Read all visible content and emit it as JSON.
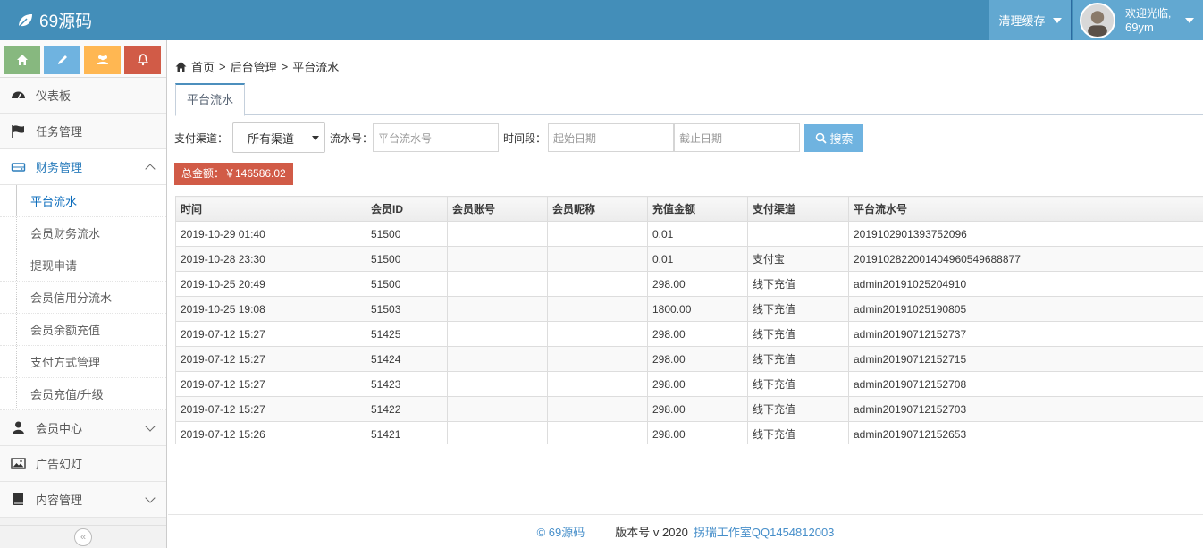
{
  "header": {
    "brand": "69源码",
    "clear_cache": "清理缓存",
    "welcome": "欢迎光临,",
    "username": "69ym"
  },
  "colors": {
    "topbar": "#438eb9",
    "shortcut_green": "#87b87f",
    "shortcut_blue": "#6fb3e0",
    "shortcut_orange": "#ffb752",
    "shortcut_red": "#d15b47",
    "total_badge": "#d15b47",
    "search_button": "#6fb3e0"
  },
  "sidebar": {
    "shortcuts": [
      "home-icon",
      "pencil-icon",
      "users-icon",
      "bell-icon"
    ],
    "items": [
      {
        "label": "仪表板",
        "icon": "dashboard-icon"
      },
      {
        "label": "任务管理",
        "icon": "flag-icon"
      },
      {
        "label": "财务管理",
        "icon": "drive-icon"
      },
      {
        "label": "会员中心",
        "icon": "user-icon"
      },
      {
        "label": "广告幻灯",
        "icon": "image-icon"
      },
      {
        "label": "内容管理",
        "icon": "book-icon"
      }
    ],
    "finance_sub": [
      "平台流水",
      "会员财务流水",
      "提现申请",
      "会员信用分流水",
      "会员余额充值",
      "支付方式管理",
      "会员充值/升级"
    ]
  },
  "breadcrumb": {
    "home": "首页",
    "sep": ">",
    "level2": "后台管理",
    "level3": "平台流水"
  },
  "tab": {
    "label": "平台流水"
  },
  "filters": {
    "channel_label": "支付渠道：",
    "channel_value": "所有渠道",
    "serial_label": "流水号：",
    "serial_placeholder": "平台流水号",
    "period_label": "时间段：",
    "start_placeholder": "起始日期",
    "end_placeholder": "截止日期",
    "search_label": "搜索"
  },
  "total": "总金额：￥146586.02",
  "table": {
    "headers": [
      "时间",
      "会员ID",
      "会员账号",
      "会员昵称",
      "充值金额",
      "支付渠道",
      "平台流水号"
    ],
    "rows": [
      [
        "2019-10-29 01:40",
        "51500",
        "",
        "",
        "0.01",
        "",
        "2019102901393752096"
      ],
      [
        "2019-10-28 23:30",
        "51500",
        "",
        "",
        "0.01",
        "支付宝",
        "2019102822001404960549688877"
      ],
      [
        "2019-10-25 20:49",
        "51500",
        "",
        "",
        "298.00",
        "线下充值",
        "admin20191025204910"
      ],
      [
        "2019-10-25 19:08",
        "51503",
        "",
        "",
        "1800.00",
        "线下充值",
        "admin20191025190805"
      ],
      [
        "2019-07-12 15:27",
        "51425",
        "",
        "",
        "298.00",
        "线下充值",
        "admin20190712152737"
      ],
      [
        "2019-07-12 15:27",
        "51424",
        "",
        "",
        "298.00",
        "线下充值",
        "admin20190712152715"
      ],
      [
        "2019-07-12 15:27",
        "51423",
        "",
        "",
        "298.00",
        "线下充值",
        "admin20190712152708"
      ],
      [
        "2019-07-12 15:27",
        "51422",
        "",
        "",
        "298.00",
        "线下充值",
        "admin20190712152703"
      ],
      [
        "2019-07-12 15:26",
        "51421",
        "",
        "",
        "298.00",
        "线下充值",
        "admin20190712152653"
      ]
    ]
  },
  "footer": {
    "copyright": "© 69源码",
    "version": "版本号 v 2020",
    "studio": "拐瑞工作室QQ1454812003"
  }
}
